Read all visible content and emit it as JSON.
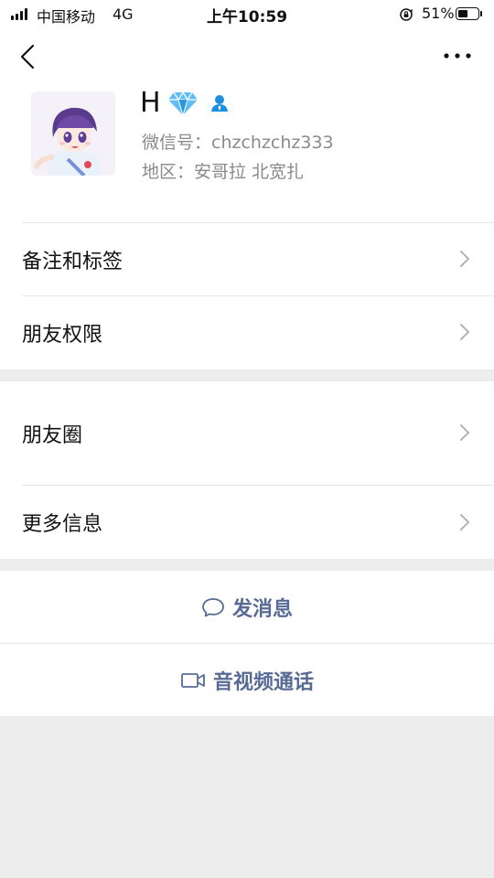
{
  "status_bar": {
    "carrier": "中国移动",
    "network": "4G",
    "time": "上午10:59",
    "battery_percent": "51%",
    "battery_level": 0.51,
    "signal_icon": "signal-bars-icon",
    "lock_icon": "orientation-lock-icon",
    "battery_icon": "battery-icon"
  },
  "nav": {
    "back_icon": "chevron-left-icon",
    "more_icon": "more-dots-icon"
  },
  "profile": {
    "name": "H",
    "badge_icons": [
      "diamond-icon",
      "contact-person-icon"
    ],
    "wechat_id": "微信号：chzchzchz333",
    "region": "地区：安哥拉 北宽扎"
  },
  "rows": {
    "remarks_tags": "备注和标签",
    "friend_permissions": "朋友权限",
    "moments": "朋友圈",
    "more_info": "更多信息"
  },
  "actions": {
    "send_message": "发消息",
    "video_call": "音视频通话"
  },
  "colors": {
    "link_blue": "#576b95",
    "background_gray": "#ededed",
    "secondary_text": "#8a8a8a",
    "diamond_blue": "#3fa9f5",
    "contact_blue": "#1c8fe0"
  }
}
